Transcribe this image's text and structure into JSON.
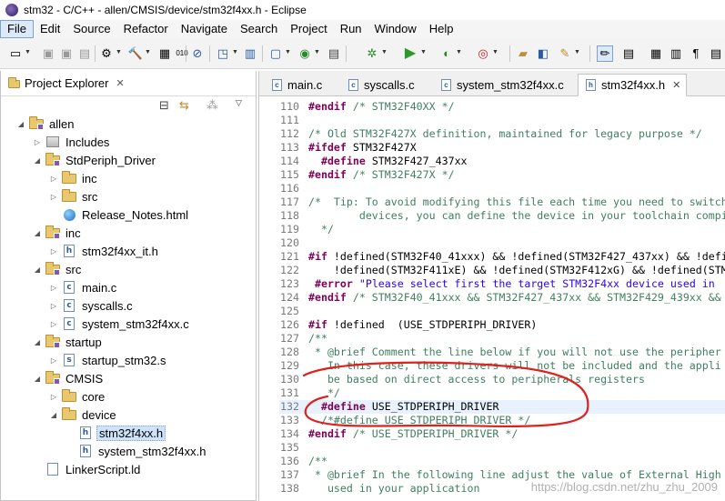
{
  "window": {
    "title": "stm32 - C/C++ - allen/CMSIS/device/stm32f4xx.h - Eclipse"
  },
  "menubar": [
    "File",
    "Edit",
    "Source",
    "Refactor",
    "Navigate",
    "Search",
    "Project",
    "Run",
    "Window",
    "Help"
  ],
  "explorer": {
    "title": "Project Explorer",
    "close": "✕",
    "tree": [
      {
        "label": "allen",
        "icon": "project-folder-icon",
        "twisty": "◢"
      },
      {
        "label": "Includes",
        "icon": "includes-icon",
        "twisty": "▷"
      },
      {
        "label": "StdPeriph_Driver",
        "icon": "source-folder-icon",
        "twisty": "◢"
      },
      {
        "label": "inc",
        "icon": "folder-icon",
        "twisty": "▷"
      },
      {
        "label": "src",
        "icon": "folder-icon",
        "twisty": "▷"
      },
      {
        "label": "Release_Notes.html",
        "icon": "html-file-icon",
        "twisty": ""
      },
      {
        "label": "inc",
        "icon": "source-folder-icon",
        "twisty": "◢"
      },
      {
        "label": "stm32f4xx_it.h",
        "icon": "header-file-icon",
        "twisty": "▷"
      },
      {
        "label": "src",
        "icon": "source-folder-icon",
        "twisty": "◢"
      },
      {
        "label": "main.c",
        "icon": "c-file-icon",
        "twisty": "▷"
      },
      {
        "label": "syscalls.c",
        "icon": "c-file-icon",
        "twisty": "▷"
      },
      {
        "label": "system_stm32f4xx.c",
        "icon": "c-file-icon",
        "twisty": "▷"
      },
      {
        "label": "startup",
        "icon": "source-folder-icon",
        "twisty": "◢"
      },
      {
        "label": "startup_stm32.s",
        "icon": "asm-file-icon",
        "twisty": "▷"
      },
      {
        "label": "CMSIS",
        "icon": "source-folder-icon",
        "twisty": "◢"
      },
      {
        "label": "core",
        "icon": "folder-icon",
        "twisty": "▷"
      },
      {
        "label": "device",
        "icon": "folder-icon",
        "twisty": "◢"
      },
      {
        "label": "stm32f4xx.h",
        "icon": "header-file-icon",
        "twisty": "",
        "selected": true
      },
      {
        "label": "system_stm32f4xx.h",
        "icon": "header-file-icon",
        "twisty": ""
      },
      {
        "label": "LinkerScript.ld",
        "icon": "file-icon",
        "twisty": ""
      }
    ]
  },
  "editor": {
    "tabs": [
      {
        "label": "main.c",
        "icon": "c",
        "active": false
      },
      {
        "label": "syscalls.c",
        "icon": "c",
        "active": false
      },
      {
        "label": "system_stm32f4xx.c",
        "icon": "c",
        "active": false
      },
      {
        "label": "stm32f4xx.h",
        "icon": "h",
        "active": true,
        "close": "✕"
      }
    ],
    "lines": [
      {
        "n": "110",
        "segs": [
          [
            "kw",
            "#endif"
          ],
          [
            "cmt",
            " /* STM32F40XX */"
          ]
        ]
      },
      {
        "n": "111",
        "segs": []
      },
      {
        "n": "112",
        "segs": [
          [
            "cmt",
            "/* Old STM32F427X definition, maintained for legacy purpose */"
          ]
        ]
      },
      {
        "n": "113",
        "segs": [
          [
            "kw",
            "#ifdef"
          ],
          [
            "",
            " STM32F427X"
          ]
        ]
      },
      {
        "n": "114",
        "segs": [
          [
            "",
            "  "
          ],
          [
            "kw",
            "#define"
          ],
          [
            "",
            " STM32F427_437xx"
          ]
        ]
      },
      {
        "n": "115",
        "segs": [
          [
            "kw",
            "#endif"
          ],
          [
            "cmt",
            " /* STM32F427X */"
          ]
        ]
      },
      {
        "n": "116",
        "segs": []
      },
      {
        "n": "117",
        "segs": [
          [
            "cmt",
            "/*  Tip: To avoid modifying this file each time you need to switch"
          ]
        ]
      },
      {
        "n": "118",
        "segs": [
          [
            "cmt",
            "        devices, you can define the device in your toolchain compi"
          ]
        ]
      },
      {
        "n": "119",
        "segs": [
          [
            "cmt",
            "  */"
          ]
        ]
      },
      {
        "n": "120",
        "segs": []
      },
      {
        "n": "121",
        "segs": [
          [
            "kw",
            "#if"
          ],
          [
            "",
            " !defined(STM32F40_41xxx) && !defined(STM32F427_437xx) && !defi"
          ]
        ]
      },
      {
        "n": "122",
        "segs": [
          [
            "",
            "    !defined(STM32F411xE) && !defined(STM32F412xG) && !defined(STM"
          ]
        ]
      },
      {
        "n": "123",
        "segs": [
          [
            "",
            " "
          ],
          [
            "kw",
            "#error"
          ],
          [
            "",
            " "
          ],
          [
            "str",
            "\"Please select first the target STM32F4xx device used in "
          ]
        ]
      },
      {
        "n": "124",
        "segs": [
          [
            "kw",
            "#endif"
          ],
          [
            "cmt",
            " /* STM32F40_41xxx && STM32F427_437xx && STM32F429_439xx && "
          ]
        ]
      },
      {
        "n": "125",
        "segs": []
      },
      {
        "n": "126",
        "segs": [
          [
            "kw",
            "#if"
          ],
          [
            "",
            " !defined  (USE_STDPERIPH_DRIVER)"
          ]
        ]
      },
      {
        "n": "127",
        "segs": [
          [
            "cmt",
            "/**"
          ]
        ]
      },
      {
        "n": "128",
        "segs": [
          [
            "cmt",
            " * @brief Comment the line below if you will not use the peripher"
          ]
        ]
      },
      {
        "n": "129",
        "segs": [
          [
            "cmt",
            "   In this case, these drivers will not be included and the appli"
          ]
        ]
      },
      {
        "n": "130",
        "segs": [
          [
            "cmt",
            "   be based on direct access to peripherals registers"
          ]
        ]
      },
      {
        "n": "131",
        "segs": [
          [
            "cmt",
            "   */"
          ]
        ]
      },
      {
        "n": "132",
        "segs": [
          [
            "",
            "  "
          ],
          [
            "kw",
            "#define"
          ],
          [
            "",
            " USE_STDPERIPH_DRIVER"
          ]
        ],
        "current": true
      },
      {
        "n": "133",
        "segs": [
          [
            "cmt",
            "  /*#define USE_STDPERIPH_DRIVER */"
          ]
        ]
      },
      {
        "n": "134",
        "segs": [
          [
            "kw",
            "#endif"
          ],
          [
            "cmt",
            " /* USE_STDPERIPH_DRIVER */"
          ]
        ]
      },
      {
        "n": "135",
        "segs": []
      },
      {
        "n": "136",
        "segs": [
          [
            "cmt",
            "/**"
          ]
        ]
      },
      {
        "n": "137",
        "segs": [
          [
            "cmt",
            " * @brief In the following line adjust the value of External High"
          ]
        ]
      },
      {
        "n": "138",
        "segs": [
          [
            "cmt",
            "   used in your application"
          ]
        ]
      }
    ]
  },
  "watermark": "https://blog.csdn.net/zhu_zhu_2009",
  "colors": {
    "annotation": "#e0201c",
    "keyword": "#7f0055",
    "comment": "#3f7f5f",
    "string": "#2a00ff"
  }
}
